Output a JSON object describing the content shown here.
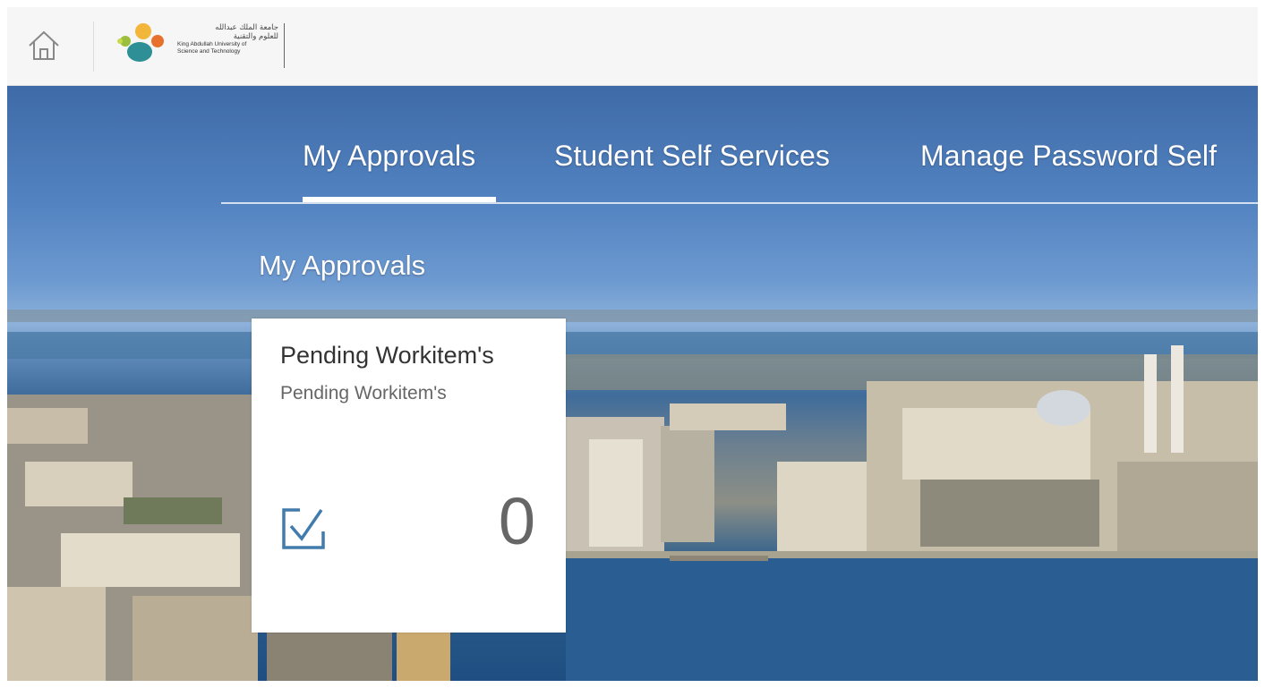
{
  "header": {
    "home_icon": "home-icon",
    "logo": {
      "arabic_line1": "جامعة الملك عبدالله",
      "arabic_line2": "للعلوم والتقنية",
      "english_line1": "King Abdullah University of",
      "english_line2": "Science and Technology"
    }
  },
  "tabs": [
    {
      "label": "My Approvals",
      "selected": true
    },
    {
      "label": "Student Self Services",
      "selected": false
    },
    {
      "label": "Manage Password Self",
      "selected": false
    }
  ],
  "section": {
    "title": "My Approvals"
  },
  "tile": {
    "title": "Pending Workitem's",
    "subtitle": "Pending Workitem's",
    "icon": "checkbox-check-icon",
    "count": "0"
  },
  "colors": {
    "accent_blue": "#427cac",
    "header_bg": "#f6f6f6",
    "tile_bg": "#ffffff"
  }
}
